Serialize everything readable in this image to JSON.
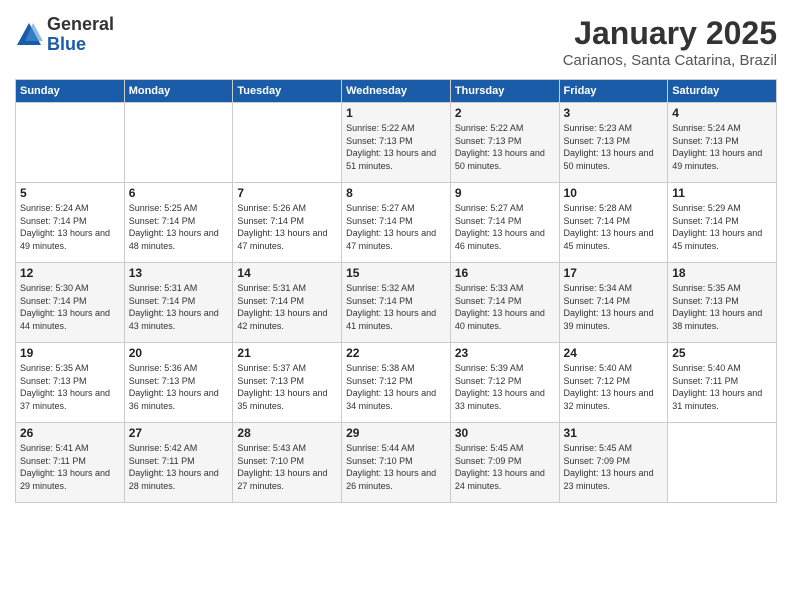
{
  "logo": {
    "general": "General",
    "blue": "Blue"
  },
  "header": {
    "month": "January 2025",
    "location": "Carianos, Santa Catarina, Brazil"
  },
  "days_of_week": [
    "Sunday",
    "Monday",
    "Tuesday",
    "Wednesday",
    "Thursday",
    "Friday",
    "Saturday"
  ],
  "weeks": [
    [
      {
        "day": "",
        "sunrise": "",
        "sunset": "",
        "daylight": ""
      },
      {
        "day": "",
        "sunrise": "",
        "sunset": "",
        "daylight": ""
      },
      {
        "day": "",
        "sunrise": "",
        "sunset": "",
        "daylight": ""
      },
      {
        "day": "1",
        "sunrise": "Sunrise: 5:22 AM",
        "sunset": "Sunset: 7:13 PM",
        "daylight": "Daylight: 13 hours and 51 minutes."
      },
      {
        "day": "2",
        "sunrise": "Sunrise: 5:22 AM",
        "sunset": "Sunset: 7:13 PM",
        "daylight": "Daylight: 13 hours and 50 minutes."
      },
      {
        "day": "3",
        "sunrise": "Sunrise: 5:23 AM",
        "sunset": "Sunset: 7:13 PM",
        "daylight": "Daylight: 13 hours and 50 minutes."
      },
      {
        "day": "4",
        "sunrise": "Sunrise: 5:24 AM",
        "sunset": "Sunset: 7:13 PM",
        "daylight": "Daylight: 13 hours and 49 minutes."
      }
    ],
    [
      {
        "day": "5",
        "sunrise": "Sunrise: 5:24 AM",
        "sunset": "Sunset: 7:14 PM",
        "daylight": "Daylight: 13 hours and 49 minutes."
      },
      {
        "day": "6",
        "sunrise": "Sunrise: 5:25 AM",
        "sunset": "Sunset: 7:14 PM",
        "daylight": "Daylight: 13 hours and 48 minutes."
      },
      {
        "day": "7",
        "sunrise": "Sunrise: 5:26 AM",
        "sunset": "Sunset: 7:14 PM",
        "daylight": "Daylight: 13 hours and 47 minutes."
      },
      {
        "day": "8",
        "sunrise": "Sunrise: 5:27 AM",
        "sunset": "Sunset: 7:14 PM",
        "daylight": "Daylight: 13 hours and 47 minutes."
      },
      {
        "day": "9",
        "sunrise": "Sunrise: 5:27 AM",
        "sunset": "Sunset: 7:14 PM",
        "daylight": "Daylight: 13 hours and 46 minutes."
      },
      {
        "day": "10",
        "sunrise": "Sunrise: 5:28 AM",
        "sunset": "Sunset: 7:14 PM",
        "daylight": "Daylight: 13 hours and 45 minutes."
      },
      {
        "day": "11",
        "sunrise": "Sunrise: 5:29 AM",
        "sunset": "Sunset: 7:14 PM",
        "daylight": "Daylight: 13 hours and 45 minutes."
      }
    ],
    [
      {
        "day": "12",
        "sunrise": "Sunrise: 5:30 AM",
        "sunset": "Sunset: 7:14 PM",
        "daylight": "Daylight: 13 hours and 44 minutes."
      },
      {
        "day": "13",
        "sunrise": "Sunrise: 5:31 AM",
        "sunset": "Sunset: 7:14 PM",
        "daylight": "Daylight: 13 hours and 43 minutes."
      },
      {
        "day": "14",
        "sunrise": "Sunrise: 5:31 AM",
        "sunset": "Sunset: 7:14 PM",
        "daylight": "Daylight: 13 hours and 42 minutes."
      },
      {
        "day": "15",
        "sunrise": "Sunrise: 5:32 AM",
        "sunset": "Sunset: 7:14 PM",
        "daylight": "Daylight: 13 hours and 41 minutes."
      },
      {
        "day": "16",
        "sunrise": "Sunrise: 5:33 AM",
        "sunset": "Sunset: 7:14 PM",
        "daylight": "Daylight: 13 hours and 40 minutes."
      },
      {
        "day": "17",
        "sunrise": "Sunrise: 5:34 AM",
        "sunset": "Sunset: 7:14 PM",
        "daylight": "Daylight: 13 hours and 39 minutes."
      },
      {
        "day": "18",
        "sunrise": "Sunrise: 5:35 AM",
        "sunset": "Sunset: 7:13 PM",
        "daylight": "Daylight: 13 hours and 38 minutes."
      }
    ],
    [
      {
        "day": "19",
        "sunrise": "Sunrise: 5:35 AM",
        "sunset": "Sunset: 7:13 PM",
        "daylight": "Daylight: 13 hours and 37 minutes."
      },
      {
        "day": "20",
        "sunrise": "Sunrise: 5:36 AM",
        "sunset": "Sunset: 7:13 PM",
        "daylight": "Daylight: 13 hours and 36 minutes."
      },
      {
        "day": "21",
        "sunrise": "Sunrise: 5:37 AM",
        "sunset": "Sunset: 7:13 PM",
        "daylight": "Daylight: 13 hours and 35 minutes."
      },
      {
        "day": "22",
        "sunrise": "Sunrise: 5:38 AM",
        "sunset": "Sunset: 7:12 PM",
        "daylight": "Daylight: 13 hours and 34 minutes."
      },
      {
        "day": "23",
        "sunrise": "Sunrise: 5:39 AM",
        "sunset": "Sunset: 7:12 PM",
        "daylight": "Daylight: 13 hours and 33 minutes."
      },
      {
        "day": "24",
        "sunrise": "Sunrise: 5:40 AM",
        "sunset": "Sunset: 7:12 PM",
        "daylight": "Daylight: 13 hours and 32 minutes."
      },
      {
        "day": "25",
        "sunrise": "Sunrise: 5:40 AM",
        "sunset": "Sunset: 7:11 PM",
        "daylight": "Daylight: 13 hours and 31 minutes."
      }
    ],
    [
      {
        "day": "26",
        "sunrise": "Sunrise: 5:41 AM",
        "sunset": "Sunset: 7:11 PM",
        "daylight": "Daylight: 13 hours and 29 minutes."
      },
      {
        "day": "27",
        "sunrise": "Sunrise: 5:42 AM",
        "sunset": "Sunset: 7:11 PM",
        "daylight": "Daylight: 13 hours and 28 minutes."
      },
      {
        "day": "28",
        "sunrise": "Sunrise: 5:43 AM",
        "sunset": "Sunset: 7:10 PM",
        "daylight": "Daylight: 13 hours and 27 minutes."
      },
      {
        "day": "29",
        "sunrise": "Sunrise: 5:44 AM",
        "sunset": "Sunset: 7:10 PM",
        "daylight": "Daylight: 13 hours and 26 minutes."
      },
      {
        "day": "30",
        "sunrise": "Sunrise: 5:45 AM",
        "sunset": "Sunset: 7:09 PM",
        "daylight": "Daylight: 13 hours and 24 minutes."
      },
      {
        "day": "31",
        "sunrise": "Sunrise: 5:45 AM",
        "sunset": "Sunset: 7:09 PM",
        "daylight": "Daylight: 13 hours and 23 minutes."
      },
      {
        "day": "",
        "sunrise": "",
        "sunset": "",
        "daylight": ""
      }
    ]
  ]
}
